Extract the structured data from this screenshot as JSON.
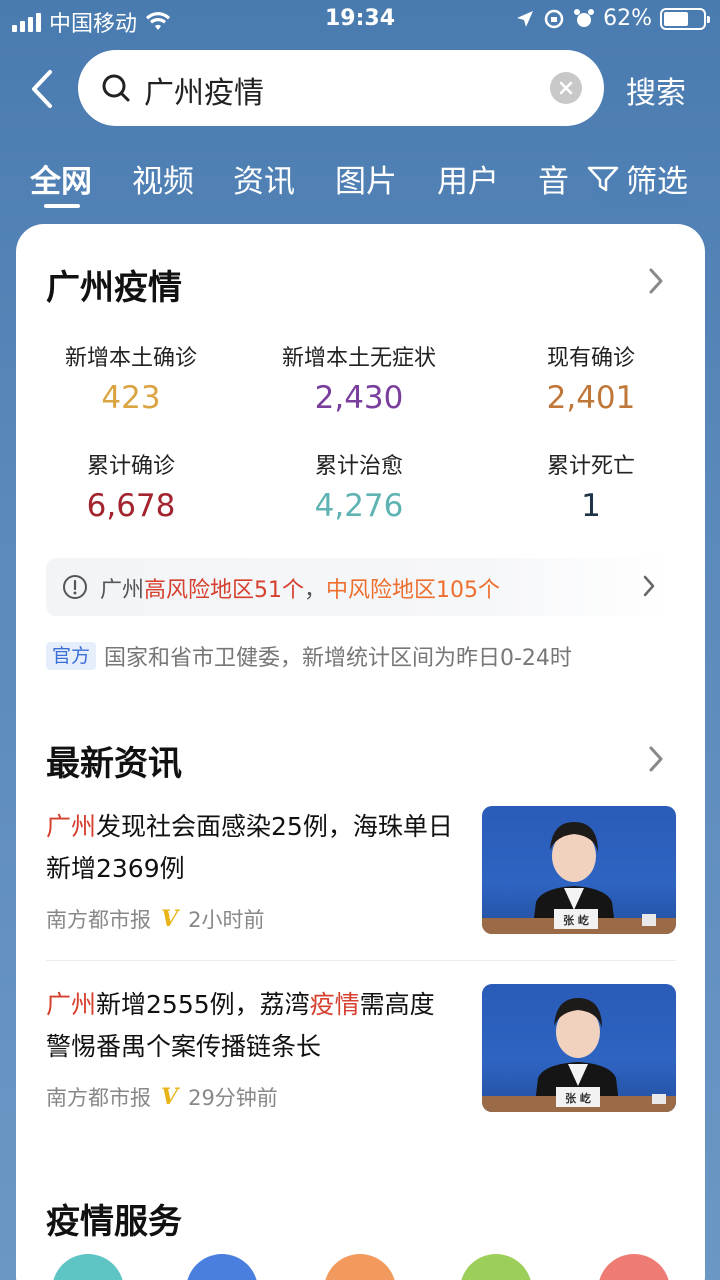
{
  "status_bar": {
    "carrier": "中国移动",
    "time": "19:34",
    "battery": "62%"
  },
  "search": {
    "query": "广州疫情",
    "button_label": "搜索"
  },
  "tabs": [
    {
      "label": "全网"
    },
    {
      "label": "视频"
    },
    {
      "label": "资讯"
    },
    {
      "label": "图片"
    },
    {
      "label": "用户"
    },
    {
      "label": "音"
    }
  ],
  "filter_label": "筛选",
  "epidemic": {
    "title": "广州疫情",
    "stats": [
      {
        "label": "新增本土确诊",
        "value": "423",
        "color": "#d9a441"
      },
      {
        "label": "新增本土无症状",
        "value": "2,430",
        "color": "#7a3e9d"
      },
      {
        "label": "现有确诊",
        "value": "2,401",
        "color": "#c0783a"
      },
      {
        "label": "累计确诊",
        "value": "6,678",
        "color": "#a3242e"
      },
      {
        "label": "累计治愈",
        "value": "4,276",
        "color": "#5fb3b3"
      },
      {
        "label": "累计死亡",
        "value": "1",
        "color": "#1e3346"
      }
    ],
    "risk": {
      "prefix": "广州",
      "high": "高风险地区51个",
      "sep": "，",
      "mid": "中风险地区105个"
    },
    "official_badge": "官方",
    "source_note": "国家和省市卫健委，新增统计区间为昨日0-24时"
  },
  "news": {
    "title": "最新资讯",
    "items": [
      {
        "title_hl": "广州",
        "title_rest": "发现社会面感染25例，海珠单日新增2369例",
        "source": "南方都市报",
        "time": "2小时前",
        "thumb_caption": "张 屹"
      },
      {
        "title_hl": "广州",
        "title_mid": "新增2555例，荔湾",
        "title_hl2": "疫情",
        "title_rest": "需高度警惕番禺个案传播链条长",
        "source": "南方都市报",
        "time": "29分钟前",
        "thumb_caption": "张 屹"
      }
    ]
  },
  "services": {
    "title": "疫情服务",
    "circle_colors": [
      "#5fc4c4",
      "#4a7fe0",
      "#f29a5e",
      "#9ccf5a",
      "#ee7c74"
    ]
  }
}
